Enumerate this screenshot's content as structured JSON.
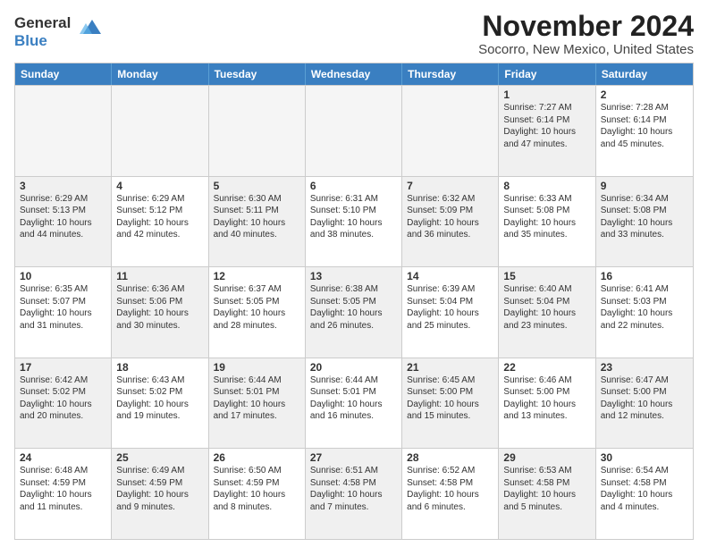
{
  "logo": {
    "line1": "General",
    "line2": "Blue"
  },
  "title": "November 2024",
  "subtitle": "Socorro, New Mexico, United States",
  "days": [
    "Sunday",
    "Monday",
    "Tuesday",
    "Wednesday",
    "Thursday",
    "Friday",
    "Saturday"
  ],
  "rows": [
    [
      {
        "day": "",
        "empty": true
      },
      {
        "day": "",
        "empty": true
      },
      {
        "day": "",
        "empty": true
      },
      {
        "day": "",
        "empty": true
      },
      {
        "day": "",
        "empty": true
      },
      {
        "day": "1",
        "shaded": true,
        "lines": [
          "Sunrise: 7:27 AM",
          "Sunset: 6:14 PM",
          "Daylight: 10 hours",
          "and 47 minutes."
        ]
      },
      {
        "day": "2",
        "lines": [
          "Sunrise: 7:28 AM",
          "Sunset: 6:14 PM",
          "Daylight: 10 hours",
          "and 45 minutes."
        ]
      }
    ],
    [
      {
        "day": "3",
        "shaded": true,
        "lines": [
          "Sunrise: 6:29 AM",
          "Sunset: 5:13 PM",
          "Daylight: 10 hours",
          "and 44 minutes."
        ]
      },
      {
        "day": "4",
        "lines": [
          "Sunrise: 6:29 AM",
          "Sunset: 5:12 PM",
          "Daylight: 10 hours",
          "and 42 minutes."
        ]
      },
      {
        "day": "5",
        "shaded": true,
        "lines": [
          "Sunrise: 6:30 AM",
          "Sunset: 5:11 PM",
          "Daylight: 10 hours",
          "and 40 minutes."
        ]
      },
      {
        "day": "6",
        "lines": [
          "Sunrise: 6:31 AM",
          "Sunset: 5:10 PM",
          "Daylight: 10 hours",
          "and 38 minutes."
        ]
      },
      {
        "day": "7",
        "shaded": true,
        "lines": [
          "Sunrise: 6:32 AM",
          "Sunset: 5:09 PM",
          "Daylight: 10 hours",
          "and 36 minutes."
        ]
      },
      {
        "day": "8",
        "lines": [
          "Sunrise: 6:33 AM",
          "Sunset: 5:08 PM",
          "Daylight: 10 hours",
          "and 35 minutes."
        ]
      },
      {
        "day": "9",
        "shaded": true,
        "lines": [
          "Sunrise: 6:34 AM",
          "Sunset: 5:08 PM",
          "Daylight: 10 hours",
          "and 33 minutes."
        ]
      }
    ],
    [
      {
        "day": "10",
        "lines": [
          "Sunrise: 6:35 AM",
          "Sunset: 5:07 PM",
          "Daylight: 10 hours",
          "and 31 minutes."
        ]
      },
      {
        "day": "11",
        "shaded": true,
        "lines": [
          "Sunrise: 6:36 AM",
          "Sunset: 5:06 PM",
          "Daylight: 10 hours",
          "and 30 minutes."
        ]
      },
      {
        "day": "12",
        "lines": [
          "Sunrise: 6:37 AM",
          "Sunset: 5:05 PM",
          "Daylight: 10 hours",
          "and 28 minutes."
        ]
      },
      {
        "day": "13",
        "shaded": true,
        "lines": [
          "Sunrise: 6:38 AM",
          "Sunset: 5:05 PM",
          "Daylight: 10 hours",
          "and 26 minutes."
        ]
      },
      {
        "day": "14",
        "lines": [
          "Sunrise: 6:39 AM",
          "Sunset: 5:04 PM",
          "Daylight: 10 hours",
          "and 25 minutes."
        ]
      },
      {
        "day": "15",
        "shaded": true,
        "lines": [
          "Sunrise: 6:40 AM",
          "Sunset: 5:04 PM",
          "Daylight: 10 hours",
          "and 23 minutes."
        ]
      },
      {
        "day": "16",
        "lines": [
          "Sunrise: 6:41 AM",
          "Sunset: 5:03 PM",
          "Daylight: 10 hours",
          "and 22 minutes."
        ]
      }
    ],
    [
      {
        "day": "17",
        "shaded": true,
        "lines": [
          "Sunrise: 6:42 AM",
          "Sunset: 5:02 PM",
          "Daylight: 10 hours",
          "and 20 minutes."
        ]
      },
      {
        "day": "18",
        "lines": [
          "Sunrise: 6:43 AM",
          "Sunset: 5:02 PM",
          "Daylight: 10 hours",
          "and 19 minutes."
        ]
      },
      {
        "day": "19",
        "shaded": true,
        "lines": [
          "Sunrise: 6:44 AM",
          "Sunset: 5:01 PM",
          "Daylight: 10 hours",
          "and 17 minutes."
        ]
      },
      {
        "day": "20",
        "lines": [
          "Sunrise: 6:44 AM",
          "Sunset: 5:01 PM",
          "Daylight: 10 hours",
          "and 16 minutes."
        ]
      },
      {
        "day": "21",
        "shaded": true,
        "lines": [
          "Sunrise: 6:45 AM",
          "Sunset: 5:00 PM",
          "Daylight: 10 hours",
          "and 15 minutes."
        ]
      },
      {
        "day": "22",
        "lines": [
          "Sunrise: 6:46 AM",
          "Sunset: 5:00 PM",
          "Daylight: 10 hours",
          "and 13 minutes."
        ]
      },
      {
        "day": "23",
        "shaded": true,
        "lines": [
          "Sunrise: 6:47 AM",
          "Sunset: 5:00 PM",
          "Daylight: 10 hours",
          "and 12 minutes."
        ]
      }
    ],
    [
      {
        "day": "24",
        "lines": [
          "Sunrise: 6:48 AM",
          "Sunset: 4:59 PM",
          "Daylight: 10 hours",
          "and 11 minutes."
        ]
      },
      {
        "day": "25",
        "shaded": true,
        "lines": [
          "Sunrise: 6:49 AM",
          "Sunset: 4:59 PM",
          "Daylight: 10 hours",
          "and 9 minutes."
        ]
      },
      {
        "day": "26",
        "lines": [
          "Sunrise: 6:50 AM",
          "Sunset: 4:59 PM",
          "Daylight: 10 hours",
          "and 8 minutes."
        ]
      },
      {
        "day": "27",
        "shaded": true,
        "lines": [
          "Sunrise: 6:51 AM",
          "Sunset: 4:58 PM",
          "Daylight: 10 hours",
          "and 7 minutes."
        ]
      },
      {
        "day": "28",
        "lines": [
          "Sunrise: 6:52 AM",
          "Sunset: 4:58 PM",
          "Daylight: 10 hours",
          "and 6 minutes."
        ]
      },
      {
        "day": "29",
        "shaded": true,
        "lines": [
          "Sunrise: 6:53 AM",
          "Sunset: 4:58 PM",
          "Daylight: 10 hours",
          "and 5 minutes."
        ]
      },
      {
        "day": "30",
        "lines": [
          "Sunrise: 6:54 AM",
          "Sunset: 4:58 PM",
          "Daylight: 10 hours",
          "and 4 minutes."
        ]
      }
    ]
  ]
}
